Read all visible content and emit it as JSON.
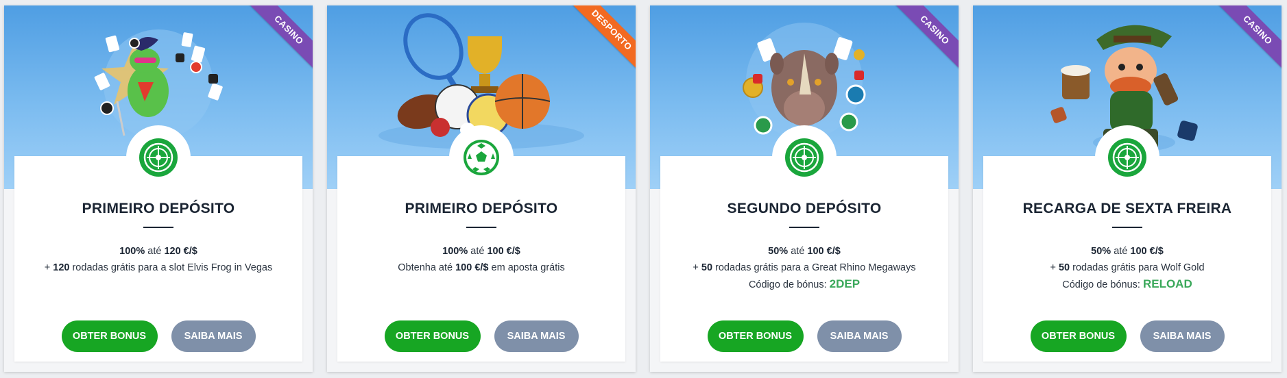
{
  "colors": {
    "casino_ribbon": "#7a4bb4",
    "sport_ribbon": "#f26a21",
    "primary_button": "#17a623",
    "secondary_button": "#7f90a9",
    "badge_green": "#1aa63c",
    "bonus_code": "#3aa85a"
  },
  "cards": [
    {
      "ribbon": "CASINO",
      "icon": "roulette-icon",
      "title": "PRIMEIRO DEPÓSITO",
      "line1": {
        "pct": "100%",
        "sep": " até ",
        "amount": "120 €/$"
      },
      "line2": {
        "pre": "+ ",
        "num": "120",
        "post": " rodadas grátis para a slot Elvis Frog in Vegas"
      },
      "code_label": "",
      "code": "",
      "primary": "OBTER BONUS",
      "secondary": "SAIBA MAIS"
    },
    {
      "ribbon": "DESPORTO",
      "icon": "soccer-ball-icon",
      "title": "PRIMEIRO DEPÓSITO",
      "line1": {
        "pct": "100%",
        "sep": " até ",
        "amount": "100 €/$"
      },
      "line2": {
        "pre": "Obtenha até ",
        "num": "100 €/$",
        "post": " em aposta grátis"
      },
      "code_label": "",
      "code": "",
      "primary": "OBTER BONUS",
      "secondary": "SAIBA MAIS"
    },
    {
      "ribbon": "CASINO",
      "icon": "roulette-icon",
      "title": "SEGUNDO DEPÓSITO",
      "line1": {
        "pct": "50%",
        "sep": " até ",
        "amount": "100 €/$"
      },
      "line2": {
        "pre": "+ ",
        "num": "50",
        "post": " rodadas grátis para a Great Rhino Megaways"
      },
      "code_label": "Código de bónus: ",
      "code": "2DEP",
      "primary": "OBTER BONUS",
      "secondary": "SAIBA MAIS"
    },
    {
      "ribbon": "CASINO",
      "icon": "roulette-icon",
      "title": "RECARGA DE SEXTA FREIRA",
      "line1": {
        "pct": "50%",
        "sep": " até ",
        "amount": "100 €/$"
      },
      "line2": {
        "pre": "+ ",
        "num": "50",
        "post": " rodadas grátis para Wolf Gold"
      },
      "code_label": "Código de bónus: ",
      "code": "RELOAD",
      "primary": "OBTER BONUS",
      "secondary": "SAIBA MAIS"
    }
  ]
}
